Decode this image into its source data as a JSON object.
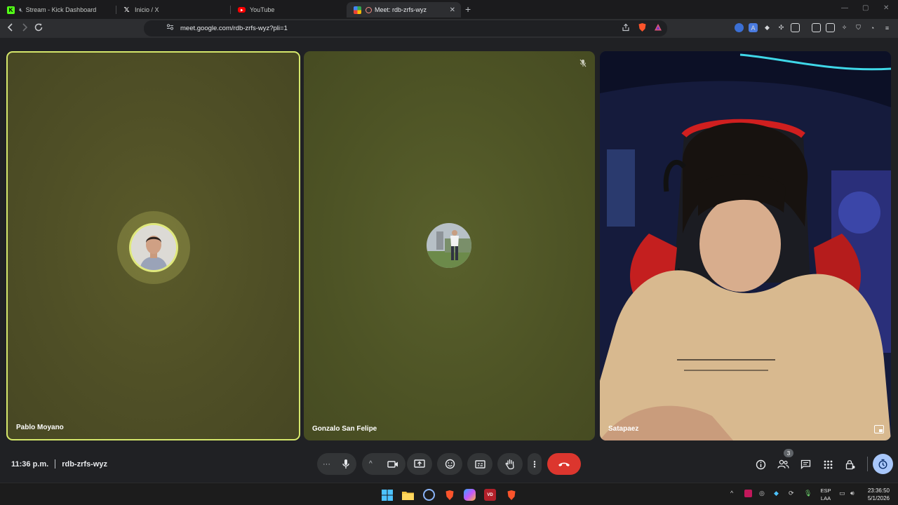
{
  "browser": {
    "tabs": [
      {
        "label": "Stream - Kick Dashboard",
        "favicon": "kick-icon"
      },
      {
        "label": "Inicio / X",
        "favicon": "x-icon"
      },
      {
        "label": "YouTube",
        "favicon": "youtube-icon"
      },
      {
        "label": "Meet: rdb-zrfs-wyz",
        "favicon": "meet-icon",
        "active": true
      }
    ],
    "url": "meet.google.com/rdb-zrfs-wyz?pli=1"
  },
  "meet": {
    "participants": [
      {
        "name": "Pablo Moyano",
        "speaking": true
      },
      {
        "name": "Gonzalo San Felipe",
        "muted": true
      },
      {
        "name": "Satapaez",
        "video_on": true
      }
    ],
    "time": "11:36 p.m.",
    "meeting_code": "rdb-zrfs-wyz",
    "people_count": "3",
    "accent_color": "#d5e76b",
    "end_call_color": "#dc362e"
  },
  "taskbar": {
    "language_line1": "ESP",
    "language_line2": "LAA",
    "clock_time": "23:36:50",
    "clock_date": "5/1/2026"
  }
}
